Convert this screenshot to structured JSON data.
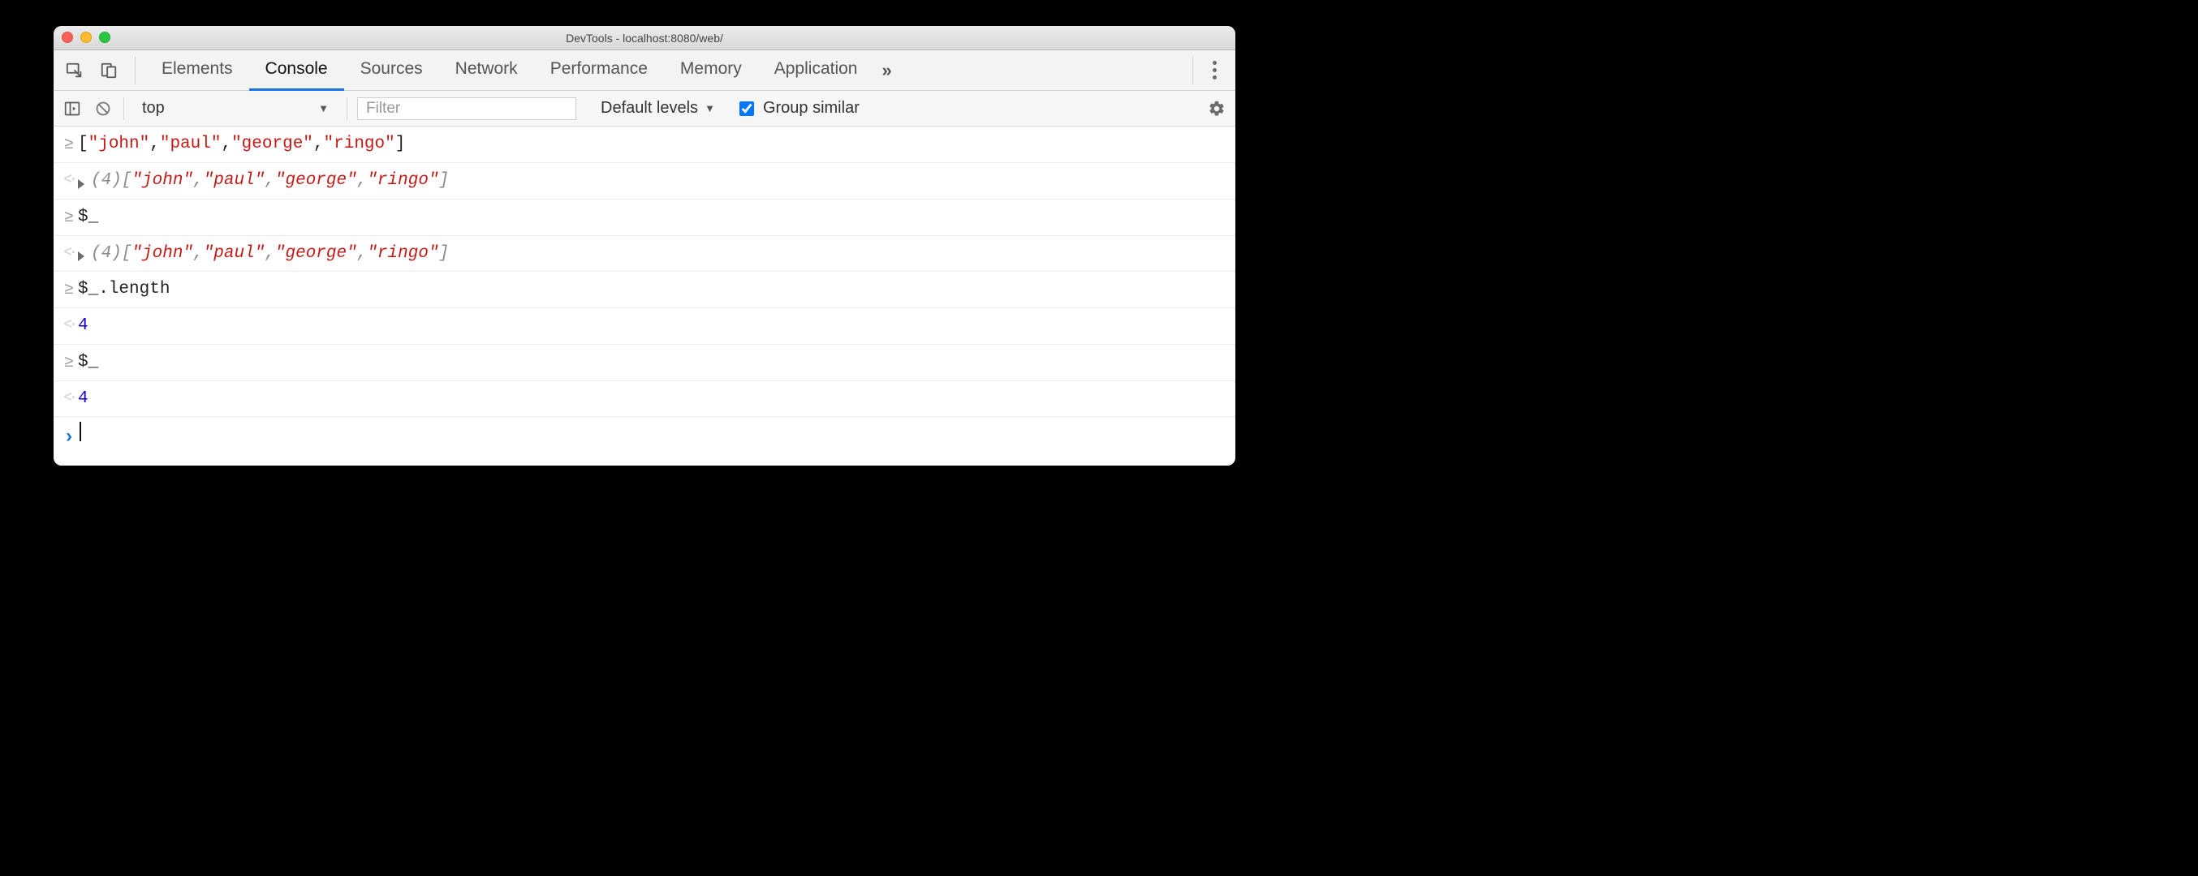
{
  "window": {
    "title": "DevTools - localhost:8080/web/"
  },
  "tabs": {
    "items": [
      {
        "label": "Elements",
        "active": false
      },
      {
        "label": "Console",
        "active": true
      },
      {
        "label": "Sources",
        "active": false
      },
      {
        "label": "Network",
        "active": false
      },
      {
        "label": "Performance",
        "active": false
      },
      {
        "label": "Memory",
        "active": false
      },
      {
        "label": "Application",
        "active": false
      }
    ],
    "more": "»"
  },
  "toolbar": {
    "context": "top",
    "filter_placeholder": "Filter",
    "levels_label": "Default levels",
    "group_similar_label": "Group similar",
    "group_similar_checked": true
  },
  "console": {
    "rows": [
      {
        "kind": "input",
        "parts": [
          {
            "t": "punct",
            "v": "["
          },
          {
            "t": "str",
            "v": "\"john\""
          },
          {
            "t": "punct",
            "v": ","
          },
          {
            "t": "str",
            "v": "\"paul\""
          },
          {
            "t": "punct",
            "v": ","
          },
          {
            "t": "str",
            "v": "\"george\""
          },
          {
            "t": "punct",
            "v": ","
          },
          {
            "t": "str",
            "v": "\"ringo\""
          },
          {
            "t": "punct",
            "v": "]"
          }
        ]
      },
      {
        "kind": "result",
        "expandable": true,
        "parts": [
          {
            "t": "dim-italic",
            "v": "(4) "
          },
          {
            "t": "dim-italic",
            "v": "["
          },
          {
            "t": "str-italic",
            "v": "\"john\""
          },
          {
            "t": "dim-italic",
            "v": ", "
          },
          {
            "t": "str-italic",
            "v": "\"paul\""
          },
          {
            "t": "dim-italic",
            "v": ", "
          },
          {
            "t": "str-italic",
            "v": "\"george\""
          },
          {
            "t": "dim-italic",
            "v": ", "
          },
          {
            "t": "str-italic",
            "v": "\"ringo\""
          },
          {
            "t": "dim-italic",
            "v": "]"
          }
        ]
      },
      {
        "kind": "input",
        "parts": [
          {
            "t": "punct",
            "v": "$_"
          }
        ]
      },
      {
        "kind": "result",
        "expandable": true,
        "parts": [
          {
            "t": "dim-italic",
            "v": "(4) "
          },
          {
            "t": "dim-italic",
            "v": "["
          },
          {
            "t": "str-italic",
            "v": "\"john\""
          },
          {
            "t": "dim-italic",
            "v": ", "
          },
          {
            "t": "str-italic",
            "v": "\"paul\""
          },
          {
            "t": "dim-italic",
            "v": ", "
          },
          {
            "t": "str-italic",
            "v": "\"george\""
          },
          {
            "t": "dim-italic",
            "v": ", "
          },
          {
            "t": "str-italic",
            "v": "\"ringo\""
          },
          {
            "t": "dim-italic",
            "v": "]"
          }
        ]
      },
      {
        "kind": "input",
        "parts": [
          {
            "t": "punct",
            "v": "$_.length"
          }
        ]
      },
      {
        "kind": "result",
        "expandable": false,
        "parts": [
          {
            "t": "num",
            "v": "4"
          }
        ]
      },
      {
        "kind": "input",
        "parts": [
          {
            "t": "punct",
            "v": "$_"
          }
        ]
      },
      {
        "kind": "result",
        "expandable": false,
        "parts": [
          {
            "t": "num",
            "v": "4"
          }
        ]
      },
      {
        "kind": "prompt"
      }
    ]
  }
}
